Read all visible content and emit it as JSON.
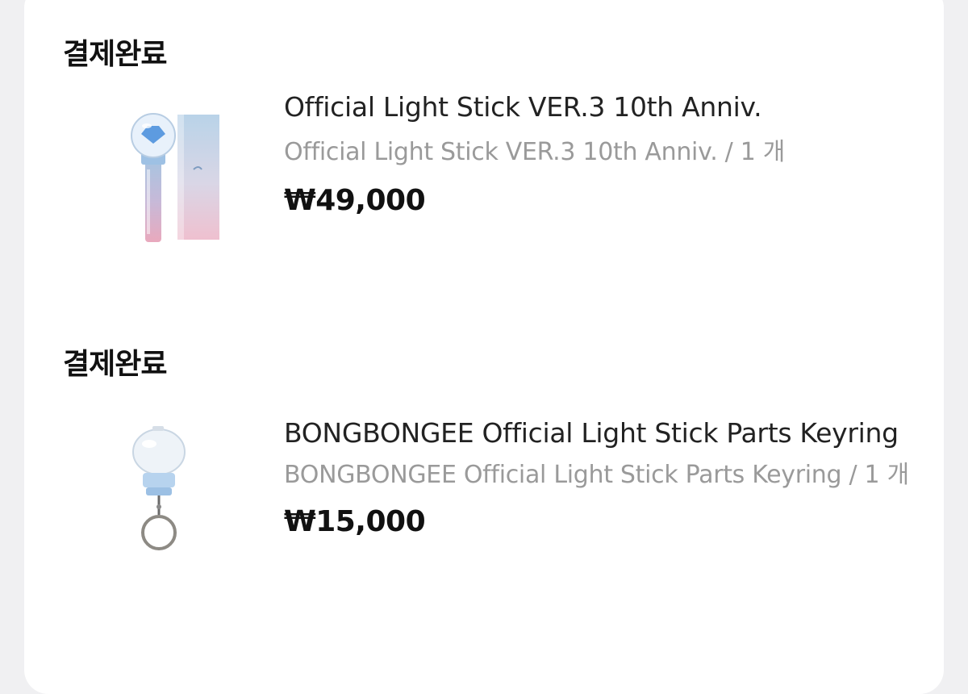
{
  "orders": [
    {
      "status": "결제완료",
      "product_name": "Official Light Stick VER.3 10th Anniv.",
      "option_text": "Official Light Stick VER.3 10th Anniv. / 1 개",
      "price": "₩49,000",
      "thumbnail_icon": "light-stick-with-box-image"
    },
    {
      "status": "결제완료",
      "product_name": "BONGBONGEE Official Light Stick Parts Keyring",
      "option_text": "BONGBONGEE Official Light Stick Parts Keyring / 1 개",
      "price": "₩15,000",
      "thumbnail_icon": "light-stick-keyring-image"
    }
  ]
}
